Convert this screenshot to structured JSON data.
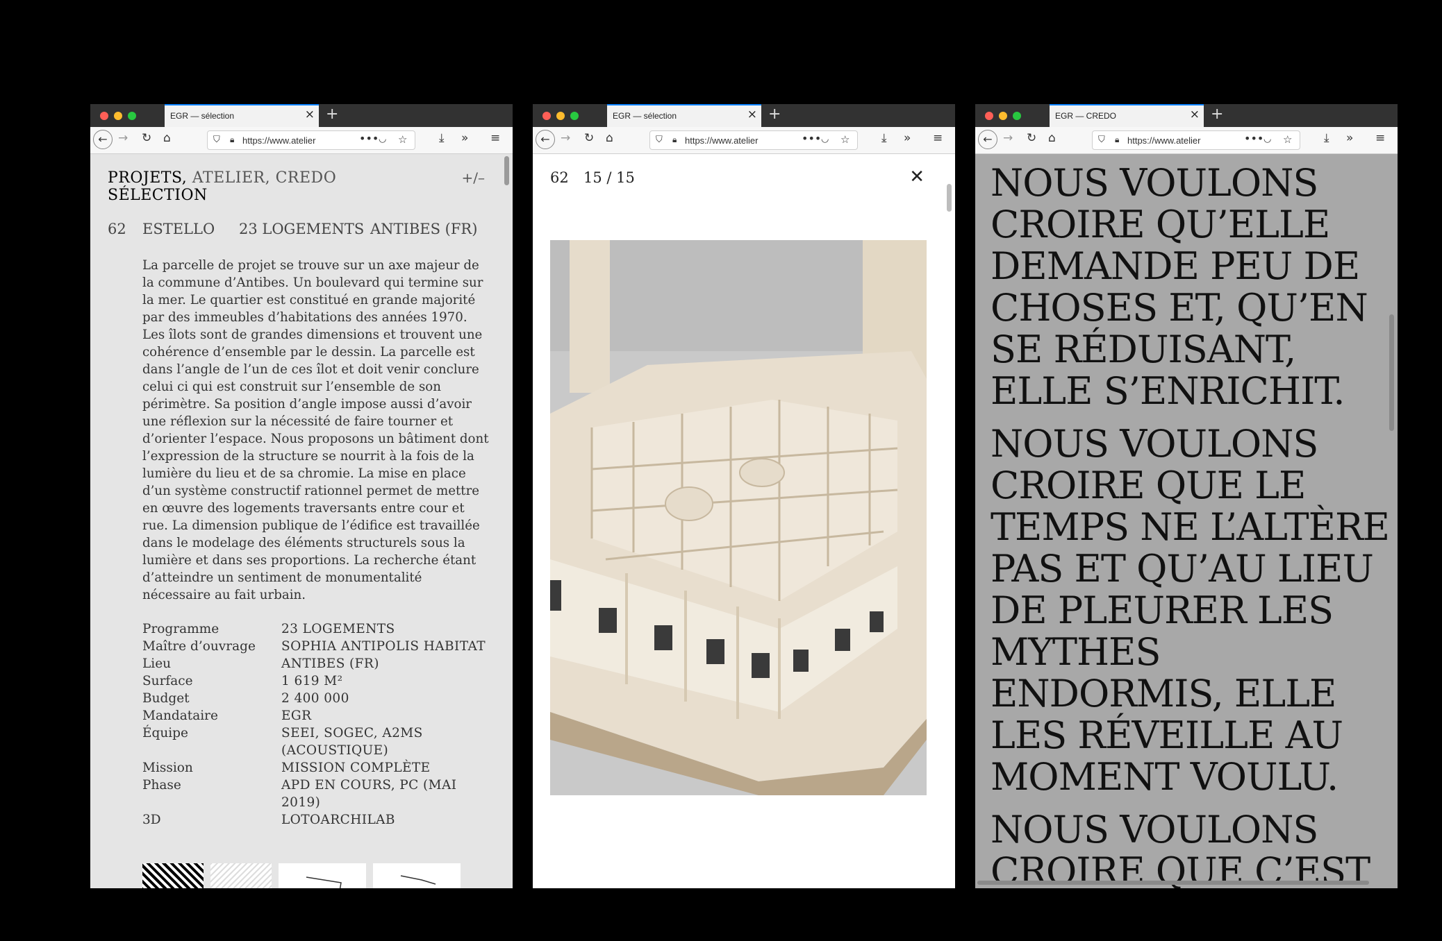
{
  "windows": [
    {
      "tab_title": "EGR — sélection",
      "url": "https://www.atelier",
      "menu": {
        "projets": "PROJETS,",
        "atelier": "ATELIER,",
        "credo": "CREDO",
        "selection": "SÉLECTION"
      },
      "toggle": "+/–",
      "project": {
        "number": "62",
        "name": "ESTELLO",
        "program": "23 LOGEMENTS",
        "location": "ANTIBES (FR)"
      },
      "description": "La parcelle de projet se trouve sur un axe majeur de la commune d’Antibes. Un boulevard qui termine sur la mer. Le quartier est constitué en grande majorité par des immeubles d’habitations des années 1970. Les îlots sont de grandes dimensions et trouvent une cohérence d’ensemble par le dessin. La parcelle est dans l’angle de l’un de ces îlot et doit venir conclure celui ci qui est construit sur l’ensemble de son périmètre. Sa position d’angle impose aussi d’avoir une réflexion sur la nécessité de faire tourner et d’orienter l’espace. Nous proposons un bâtiment dont l’expression de la structure se nourrit à la fois de la lumière du lieu et de sa chromie. La mise en place d’un système constructif rationnel permet de mettre en œuvre des logements traversants entre cour et rue. La dimension publique de l’édifice est travaillée dans le modelage des éléments structurels sous la lumière et dans ses proportions. La recherche étant d’atteindre un sentiment de monumentalité nécessaire au fait urbain.",
      "facts": [
        {
          "label": "Programme",
          "value": "23 LOGEMENTS"
        },
        {
          "label": "Maître d’ouvrage",
          "value": "SOPHIA ANTIPOLIS HABITAT"
        },
        {
          "label": "Lieu",
          "value": "ANTIBES (FR)"
        },
        {
          "label": "Surface",
          "value": "1 619 M²"
        },
        {
          "label": "Budget",
          "value": "2 400 000"
        },
        {
          "label": "Mandataire",
          "value": "EGR"
        },
        {
          "label": "Équipe",
          "value": "SEEI, SOGEC, A2MS (ACOUSTIQUE)"
        },
        {
          "label": "Mission",
          "value": "MISSION COMPLÈTE"
        },
        {
          "label": "Phase",
          "value": "APD EN COURS, PC (MAI 2019)"
        },
        {
          "label": "3D",
          "value": "LOTOARCHILAB"
        }
      ]
    },
    {
      "tab_title": "EGR — sélection",
      "url": "https://www.atelier",
      "number": "62",
      "counter": "15 / 15"
    },
    {
      "tab_title": "EGR — CREDO",
      "url": "https://www.atelier",
      "paragraphs": [
        "Nous voulons croire qu’elle demande peu de choses et, qu’en se réduisant, elle s’enrichit.",
        "Nous voulons croire que le temps ne l’altère pas et qu’au lieu de pleurer les mythes endormis, elle les réveille au moment voulu.",
        "Nous voulons croire que c’est dans son"
      ]
    }
  ],
  "icons": {
    "close": "✕",
    "plus": "+"
  }
}
